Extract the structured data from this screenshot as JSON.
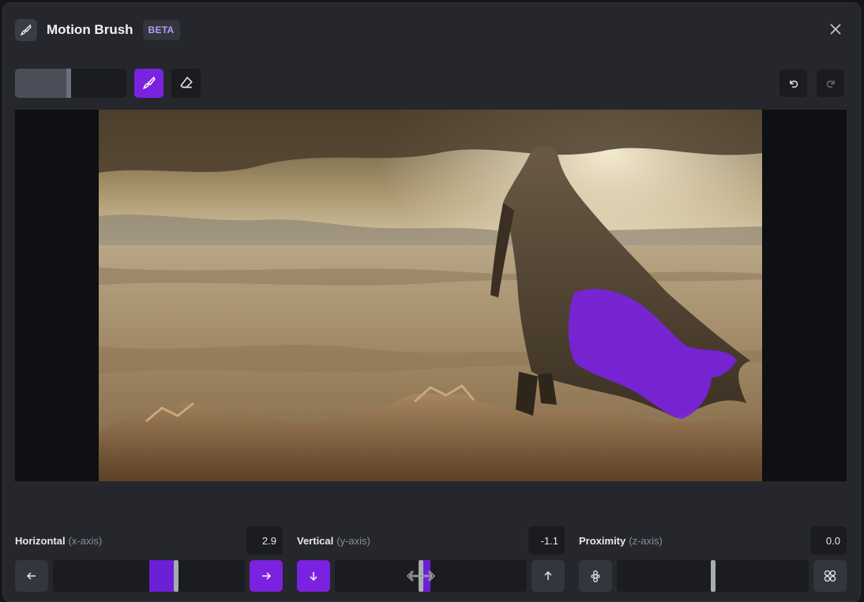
{
  "header": {
    "title": "Motion Brush",
    "badge": "BETA",
    "brush_icon": "brush-icon",
    "close_icon": "close-icon"
  },
  "toolbar": {
    "brush_size": 0.5,
    "brush_tool": "brush-icon",
    "eraser_tool": "eraser-icon",
    "undo": "undo-icon",
    "redo": "redo-icon"
  },
  "canvas": {
    "mask_color": "#7b22e0"
  },
  "controls": {
    "horizontal": {
      "label": "Horizontal",
      "sub": "(x-axis)",
      "value": "2.9",
      "left_icon": "arrow-left-icon",
      "right_icon": "arrow-right-icon",
      "slider_value": 2.9
    },
    "vertical": {
      "label": "Vertical",
      "sub": "(y-axis)",
      "value": "-1.1",
      "left_icon": "arrow-down-icon",
      "right_icon": "arrow-up-icon",
      "slider_value": -1.1
    },
    "proximity": {
      "label": "Proximity",
      "sub": "(z-axis)",
      "value": "0.0",
      "left_icon": "shrink-icon",
      "right_icon": "expand-icon",
      "slider_value": 0.0
    }
  },
  "colors": {
    "accent": "#7b22e0",
    "panel": "#25272c",
    "field": "#1b1c20"
  }
}
